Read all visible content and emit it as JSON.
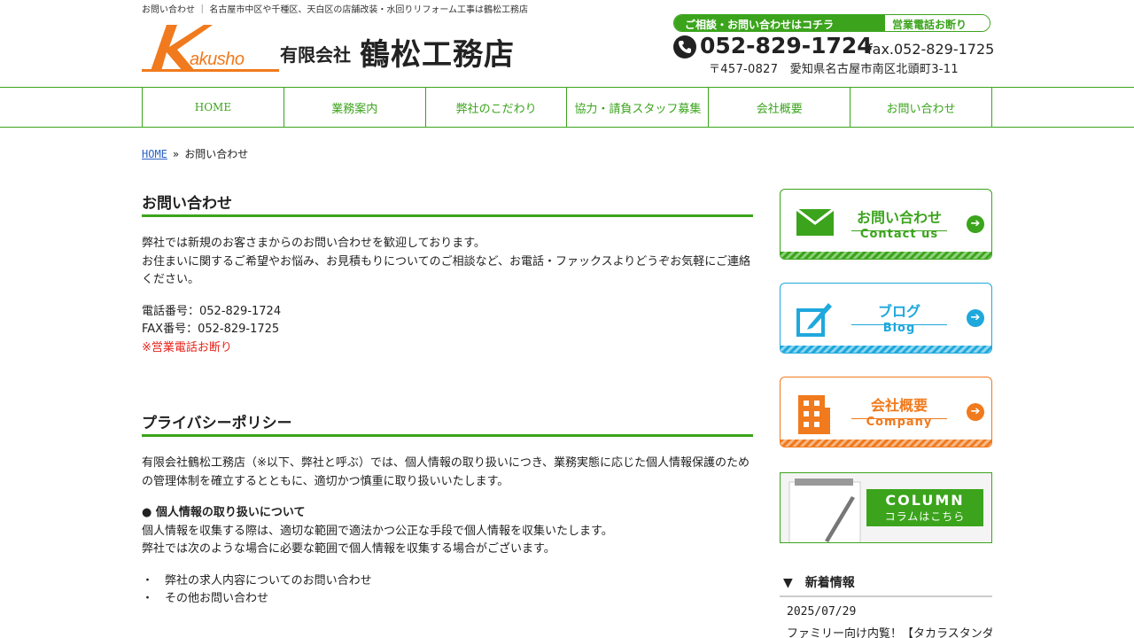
{
  "header": {
    "tagline": "お問い合わせ ｜ 名古屋市中区や千種区、天白区の店舗改装・水回りリフォーム工事は鶴松工務店",
    "logo_akusho": "akusho",
    "logo_company_type": "有限会社",
    "logo_company_name": "鶴松工務店",
    "contact_banner_left": "ご相談・お問い合わせはコチラ",
    "contact_banner_right": "営業電話お断り",
    "phone": "052-829-1724",
    "fax": "fax.052-829-1725",
    "address": "〒457-0827　愛知県名古屋市南区北頭町3-11"
  },
  "nav": {
    "items": [
      {
        "label": "HOME"
      },
      {
        "label": "業務案内"
      },
      {
        "label": "弊社のこだわり"
      },
      {
        "label": "協力・請負スタッフ募集"
      },
      {
        "label": "会社概要"
      },
      {
        "label": "お問い合わせ"
      }
    ]
  },
  "breadcrumb": {
    "home": "HOME",
    "separator": "»",
    "current": "お問い合わせ"
  },
  "main": {
    "contact_heading": "お問い合わせ",
    "intro_line1": "弊社では新規のお客さまからのお問い合わせを歓迎しております。",
    "intro_line2": "お住まいに関するご希望やお悩み、お見積もりについてのご相談など、お電話・ファックスよりどうぞお気軽にご連絡ください。",
    "tel": "電話番号：052-829-1724",
    "fax": "FAX番号：052-829-1725",
    "notice": "※営業電話お断り",
    "privacy_heading": "プライバシーポリシー",
    "privacy_intro": "有限会社鶴松工務店（※以下、弊社と呼ぶ）では、個人情報の取り扱いにつき、業務実態に応じた個人情報保護のための管理体制を確立するとともに、適切かつ慎重に取り扱いいたします。",
    "privacy_sub_heading": "● 個人情報の取り扱いについて",
    "privacy_sub_line1": "個人情報を収集する際は、適切な範囲で適法かつ公正な手段で個人情報を収集いたします。",
    "privacy_sub_line2": "弊社では次のような場合に必要な範囲で個人情報を収集する場合がございます。",
    "list": [
      "・　弊社の求人内容についてのお問い合わせ",
      "・　その他お問い合わせ"
    ]
  },
  "sidebar": {
    "contact": {
      "title": "お問い合わせ",
      "subtitle": "Contact us",
      "color": "#3ba41c"
    },
    "blog": {
      "title": "ブログ",
      "subtitle": "Blog",
      "color": "#1ea8dc"
    },
    "company": {
      "title": "会社概要",
      "subtitle": "Company",
      "color": "#f07a1d"
    },
    "column": {
      "title": "COLUMN",
      "subtitle": "コラムはこちら"
    },
    "news_heading": "▼　新着情報",
    "news": [
      {
        "date": "2025/07/29",
        "title": "ファミリー向け内覧！【タカラスタンダード】"
      }
    ]
  }
}
